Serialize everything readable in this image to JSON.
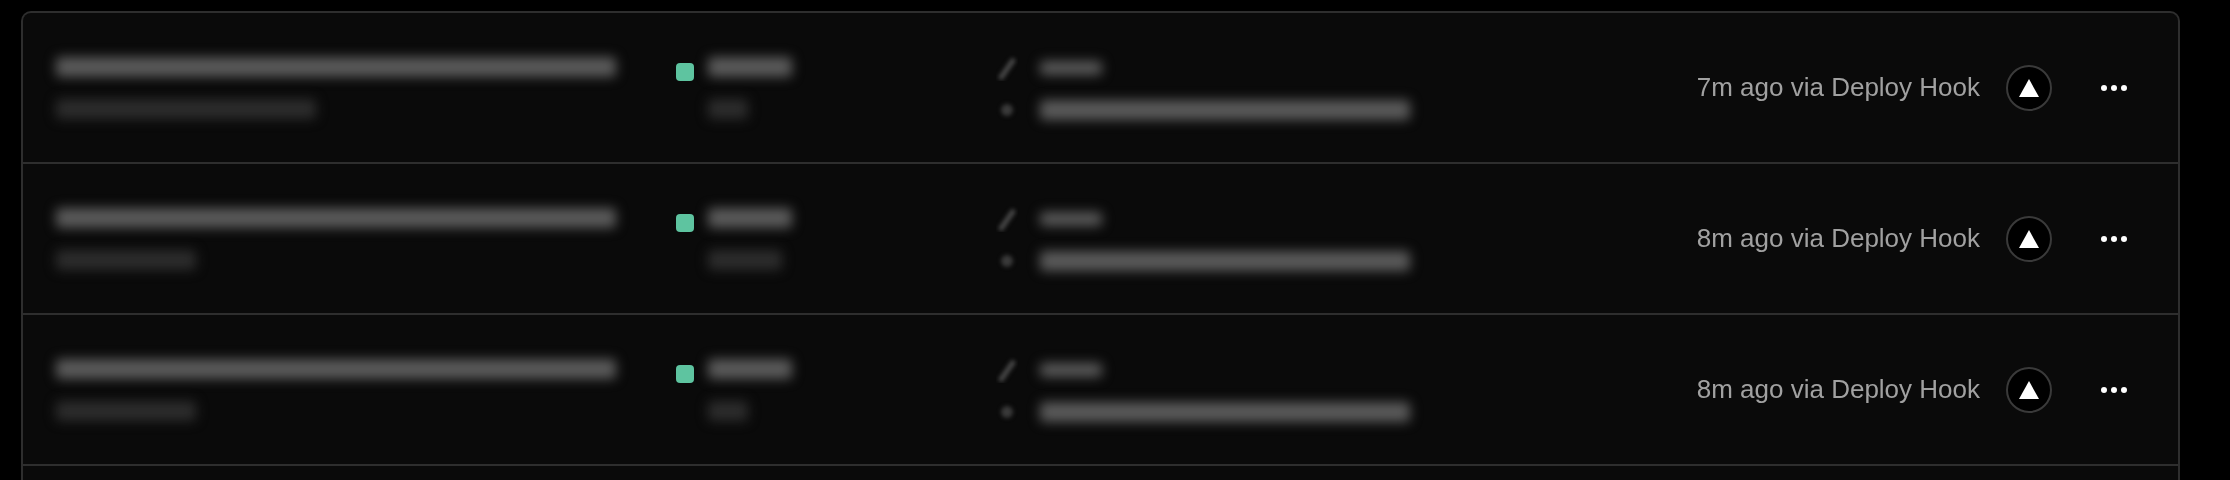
{
  "deployments": [
    {
      "color": "#5ec4a0",
      "time": "7m ago via Deploy Hook"
    },
    {
      "color": "#5ec4a0",
      "time": "8m ago via Deploy Hook"
    },
    {
      "color": "#5ec4a0",
      "time": "8m ago via Deploy Hook"
    }
  ]
}
